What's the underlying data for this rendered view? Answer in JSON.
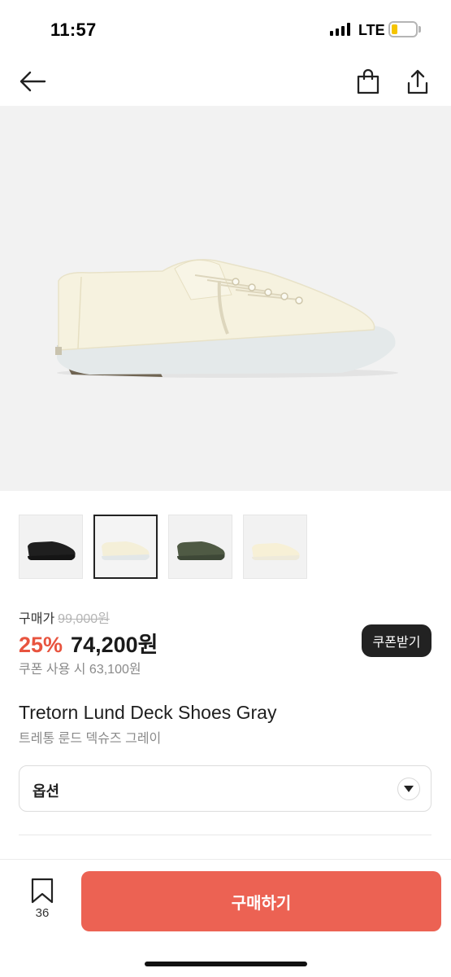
{
  "status_bar": {
    "time": "11:57",
    "network": "LTE",
    "battery_level": 0.25,
    "battery_color": "#f5c400"
  },
  "nav": {
    "back_icon": "arrow-left-icon",
    "bag_icon": "shopping-bag-icon",
    "share_icon": "share-icon"
  },
  "hero": {
    "image": "cream-canvas-low-top-sneaker"
  },
  "thumbnails": [
    {
      "name": "black-sneaker",
      "selected": false
    },
    {
      "name": "cream-sneaker",
      "selected": true
    },
    {
      "name": "olive-sneaker",
      "selected": false
    },
    {
      "name": "cream-sneaker-alt",
      "selected": false
    }
  ],
  "price": {
    "label": "구매가",
    "original": "99,000원",
    "discount": "25%",
    "current": "74,200원",
    "coupon_price": "쿠폰 사용 시 63,100원",
    "coupon_button": "쿠폰받기",
    "discount_color": "#e8543f"
  },
  "product": {
    "name": "Tretorn Lund Deck Shoes Gray",
    "name_ko": "트레통 룬드 덱슈즈 그레이"
  },
  "option": {
    "label": "옵션",
    "icon": "chevron-down-icon"
  },
  "bottom": {
    "bookmark_icon": "bookmark-icon",
    "bookmark_count": "36",
    "buy_label": "구매하기",
    "buy_color": "#ec6253"
  }
}
